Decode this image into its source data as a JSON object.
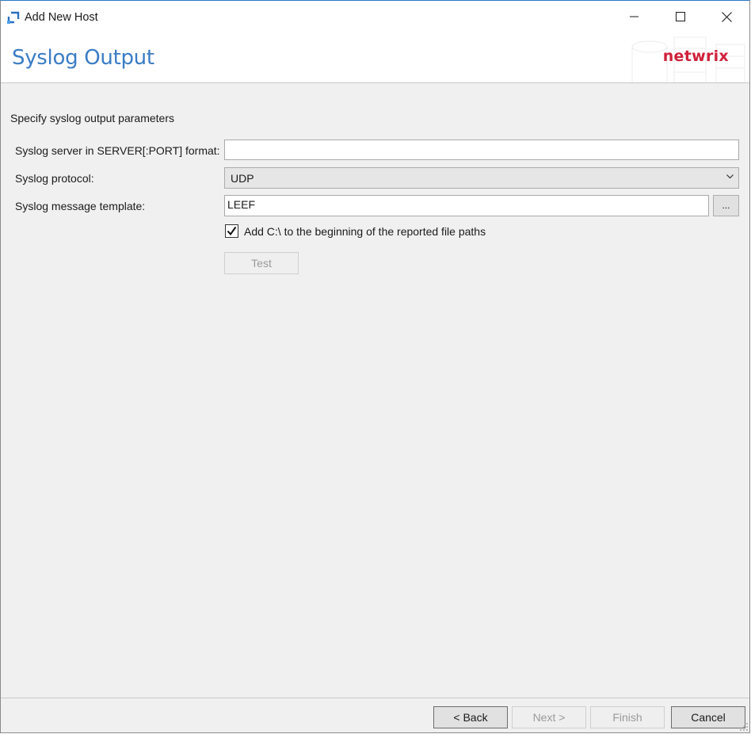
{
  "window": {
    "title": "Add New Host",
    "icons": {
      "app": "app-sync-icon",
      "minimize": "minimize-icon",
      "maximize": "maximize-icon",
      "close": "close-icon"
    }
  },
  "header": {
    "title": "Syslog Output",
    "brand": "netwrix",
    "brand_color": "#d0203a",
    "title_color": "#3a7cc5"
  },
  "form": {
    "heading": "Specify syslog output parameters",
    "server": {
      "label": "Syslog server in SERVER[:PORT] format:",
      "value": ""
    },
    "protocol": {
      "label": "Syslog protocol:",
      "selected": "UDP"
    },
    "template": {
      "label": "Syslog message template:",
      "value": "LEEF",
      "browse_label": "..."
    },
    "add_prefix": {
      "label": "Add C:\\ to the beginning of the reported file paths",
      "checked": true
    },
    "test_label": "Test"
  },
  "footer": {
    "back_label": "< Back",
    "next_label": "Next >",
    "finish_label": "Finish",
    "cancel_label": "Cancel"
  }
}
